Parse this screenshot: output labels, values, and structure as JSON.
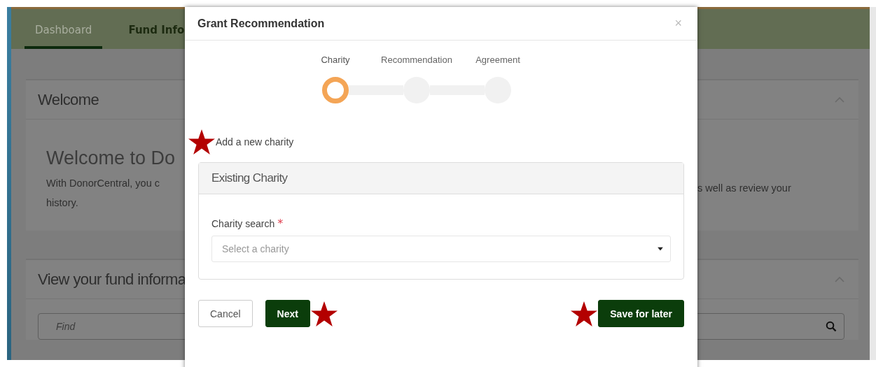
{
  "background": {
    "tabs": [
      {
        "label": "Dashboard",
        "selected": true
      },
      {
        "label": "Fund Info",
        "selected": false
      }
    ],
    "cards": [
      {
        "kind": "welcome",
        "title": "Welcome",
        "expanded": true,
        "heading": "Welcome to Do",
        "text_left": [
          "With DonorCentral, you c",
          "history."
        ],
        "text_right": [
          "s well as review your"
        ]
      },
      {
        "kind": "search",
        "title": "View your fund informa",
        "expanded": true,
        "placeholder": "Find"
      }
    ]
  },
  "modal": {
    "title": "Grant Recommendation",
    "close": "×",
    "steps": [
      {
        "label": "Charity",
        "selected": true
      },
      {
        "label": "Recommendation",
        "selected": false
      },
      {
        "label": "Agreement",
        "selected": false
      }
    ],
    "add_link": "Add a new charity",
    "panel": {
      "title": "Existing Charity",
      "field": {
        "label": "Charity search",
        "required_mark": "*",
        "placeholder": "Select a charity"
      }
    },
    "buttons": [
      {
        "label": "Cancel",
        "kind": "secondary"
      },
      {
        "label": "Next",
        "kind": "primary"
      },
      {
        "label": "Save for later",
        "kind": "primary"
      }
    ]
  }
}
